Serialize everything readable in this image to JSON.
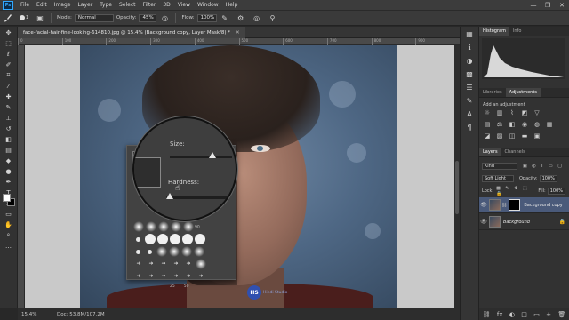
{
  "menu": {
    "logo": "Ps",
    "items": [
      "File",
      "Edit",
      "Image",
      "Layer",
      "Type",
      "Select",
      "Filter",
      "3D",
      "View",
      "Window",
      "Help"
    ],
    "window_controls": [
      "—",
      "❐",
      "✕"
    ]
  },
  "options": {
    "brush_size": "1",
    "mode_label": "Mode:",
    "mode_value": "Normal",
    "opacity_label": "Opacity:",
    "opacity_value": "45%",
    "flow_label": "Flow:",
    "flow_value": "100%"
  },
  "document": {
    "tab_title": "face-facial-hair-fine-looking-614810.jpg @ 15.4% (Background copy, Layer Mask/8) *",
    "close": "✕"
  },
  "ruler": [
    "0",
    "100",
    "200",
    "300",
    "400",
    "500",
    "600",
    "700",
    "800",
    "900"
  ],
  "brush_picker": {
    "size_label": "Size:",
    "size_value": "700 px",
    "hardness_label": "Hardness:",
    "hardness_value": "0%",
    "tip_numbers": [
      "90",
      "25",
      "50"
    ]
  },
  "magnifier": {
    "size_label": "Size:",
    "hardness_label": "Hardness:"
  },
  "watermark": {
    "logo": "HS",
    "text": "Hindi Studio"
  },
  "status": {
    "zoom": "15.4%",
    "doc_info": "Doc: 53.8M/107.2M"
  },
  "panels": {
    "top_tabs": [
      "Histogram",
      "Info"
    ],
    "mid_tabs": [
      "Libraries",
      "Adjustments"
    ],
    "adjustments_title": "Add an adjustment",
    "layers_tabs": [
      "Layers",
      "Channels"
    ],
    "kind_value": "Kind",
    "blend_mode": "Soft Light",
    "opacity_label": "Opacity:",
    "opacity_value": "100%",
    "lock_label": "Lock:",
    "fill_label": "Fill:",
    "fill_value": "100%",
    "layers": [
      {
        "name": "Background copy",
        "selected": true
      },
      {
        "name": "Background",
        "selected": false
      }
    ],
    "footer_icons": [
      "fx",
      "◐",
      "□",
      "▭",
      "+",
      "🗑"
    ]
  },
  "colors": {
    "accent": "#31a8ff",
    "selected_layer": "#4a5a7a"
  }
}
